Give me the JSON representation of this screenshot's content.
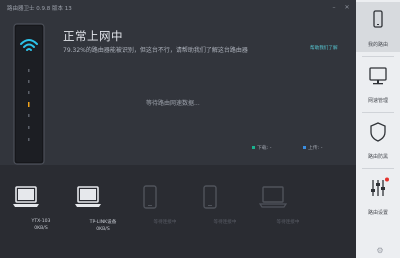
{
  "window": {
    "title": "路由器卫士 0.9.8 版本 13",
    "min_glyph": "–",
    "close_glyph": "✕"
  },
  "status": {
    "headline": "正常上网中",
    "detail": "79.32%的路由器能被识别，但这台不行，请帮助我们了解这台路由器",
    "help_link": "帮助我们了解",
    "waiting": "等待路由网速数据..."
  },
  "legend": {
    "download_label": "下载: -",
    "upload_label": "上传: -",
    "download_color": "#19b28f",
    "upload_color": "#3a8de0"
  },
  "devices": [
    {
      "name": "YTX-103",
      "speed": "0KB/S",
      "type": "laptop",
      "online": true
    },
    {
      "name": "TP-LINK设备",
      "speed": "0KB/S",
      "type": "laptop",
      "online": true
    },
    {
      "name": "等待连接中",
      "speed": "",
      "type": "phone",
      "online": false
    },
    {
      "name": "等待连接中",
      "speed": "",
      "type": "phone",
      "online": false
    },
    {
      "name": "等待连接中",
      "speed": "",
      "type": "laptop",
      "online": false
    }
  ],
  "sidebar": {
    "items": [
      {
        "label": "我的路由",
        "icon": "phone-icon",
        "active": true
      },
      {
        "label": "网速管理",
        "icon": "monitor-icon",
        "active": false
      },
      {
        "label": "路由防黑",
        "icon": "shield-icon",
        "active": false
      },
      {
        "label": "路由设置",
        "icon": "sliders-icon",
        "active": false,
        "badge": true
      }
    ],
    "settings_glyph": "⚙"
  },
  "colors": {
    "accent": "#19b28f",
    "wifi": "#2cc3ea",
    "led": "#f0a21a",
    "background": "#32353c"
  }
}
